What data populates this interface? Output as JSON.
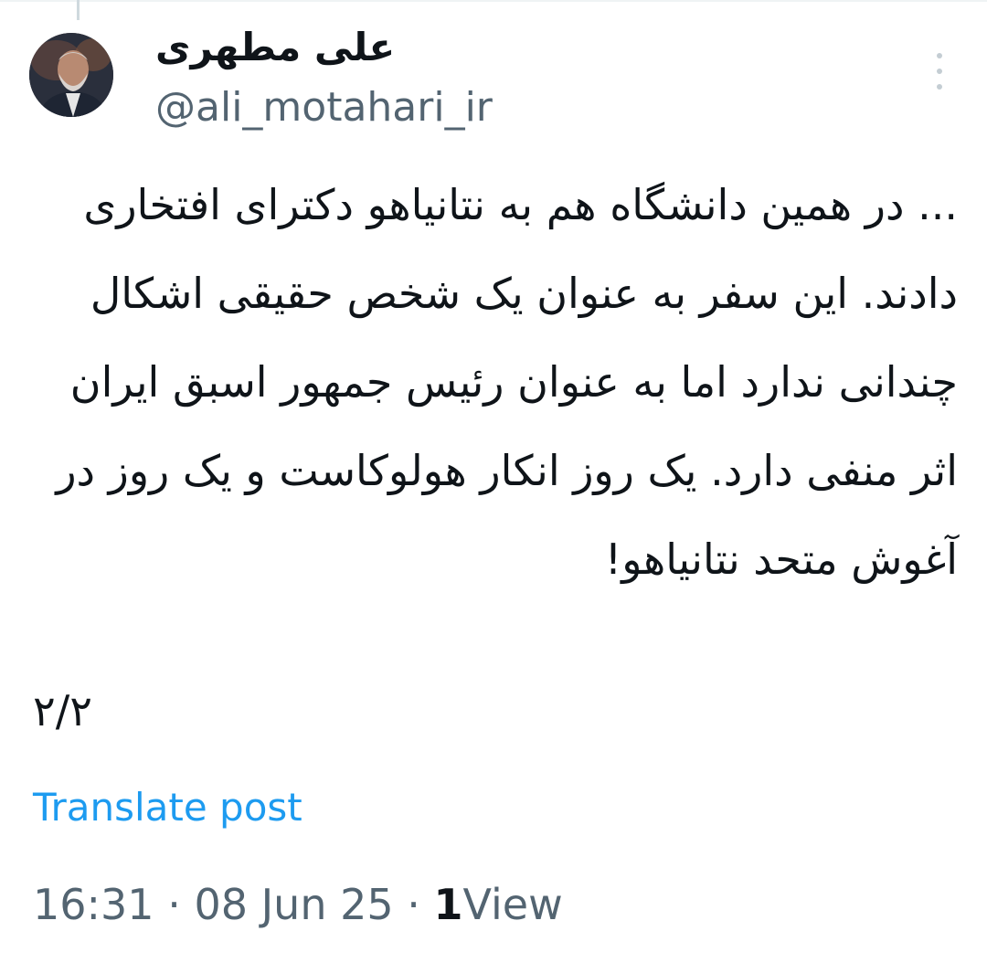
{
  "author": {
    "display_name": "علی مطهری",
    "handle": "@ali_motahari_ir"
  },
  "tweet": {
    "text": "... در همین دانشگاه هم به نتانیاهو دکترای افتخاری دادند. این سفر به عنوان یک شخص حقیقی اشکال چندانی ندارد اما به عنوان رئیس جمهور اسبق ایران اثر منفی دارد. یک روز انکار هولوکاست و یک روز در آغوش متحد نتانیاهو!",
    "thread_count": "۲/۲",
    "translate_label": "Translate post"
  },
  "meta": {
    "time": "16:31",
    "separator": "·",
    "date": "08 Jun 25",
    "views_count": "1",
    "views_label": "View"
  },
  "icons": {
    "more": "more-vertical-icon"
  },
  "colors": {
    "link": "#1d9bf0",
    "secondary_text": "#536471",
    "primary_text": "#0f1419"
  }
}
